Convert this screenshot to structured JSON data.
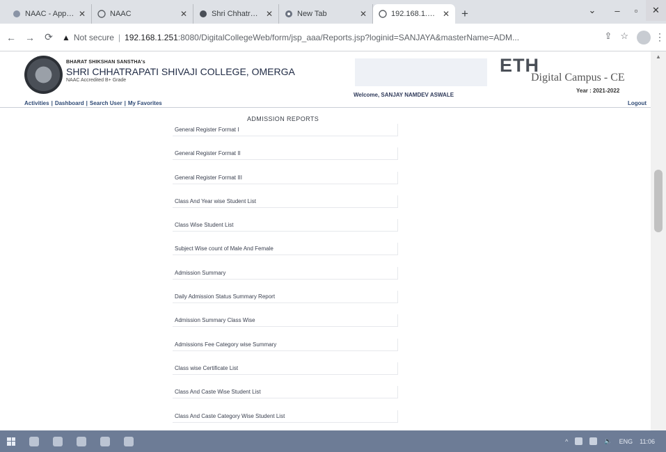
{
  "browser": {
    "tabs": [
      {
        "label": "NAAC - Apply C...",
        "active": false
      },
      {
        "label": "NAAC",
        "active": false
      },
      {
        "label": "Shri Chhatrapati",
        "active": false
      },
      {
        "label": "New Tab",
        "active": false
      },
      {
        "label": "192.168.1.251:80",
        "active": true
      }
    ],
    "new_tab_symbol": "+",
    "address": {
      "security_label": "Not secure",
      "host": "192.168.1.251",
      "path": ":8080/DigitalCollegeWeb/form/jsp_aaa/Reports.jsp?loginid=SANJAYA&masterName=ADM..."
    }
  },
  "header": {
    "org_small": "BHARAT SHIKSHAN SANSTHA's",
    "college_name": "SHRI CHHATRAPATI SHIVAJI COLLEGE, OMERGA",
    "grade": "NAAC Accredited B+ Grade",
    "welcome": "Welcome, SANJAY NAMDEV ASWALE",
    "brand": "ETH",
    "product": "Digital Campus - CE",
    "year": "Year : 2021-2022"
  },
  "nav": {
    "links": [
      "Activities",
      "Dashboard",
      "Search User",
      "My Favorites"
    ],
    "logout": "Logout"
  },
  "reports": {
    "title": "ADMISSION REPORTS",
    "items": [
      "General Register Format I",
      "General Register Format II",
      "General Register Format III",
      "Class And Year wise Student List",
      "Class Wise Student List",
      "Subject Wise count of Male And Female",
      "Admission Summary",
      "Daily Admission Status Summary Report",
      "Admission Summary Class Wise",
      "Admissions Fee Category wise Summary",
      "Class wise Certificate List",
      "Class And Caste Wise Student List",
      "Class And Caste Category Wise Student List"
    ]
  },
  "taskbar": {
    "language": "ENG",
    "time": "11:06"
  }
}
